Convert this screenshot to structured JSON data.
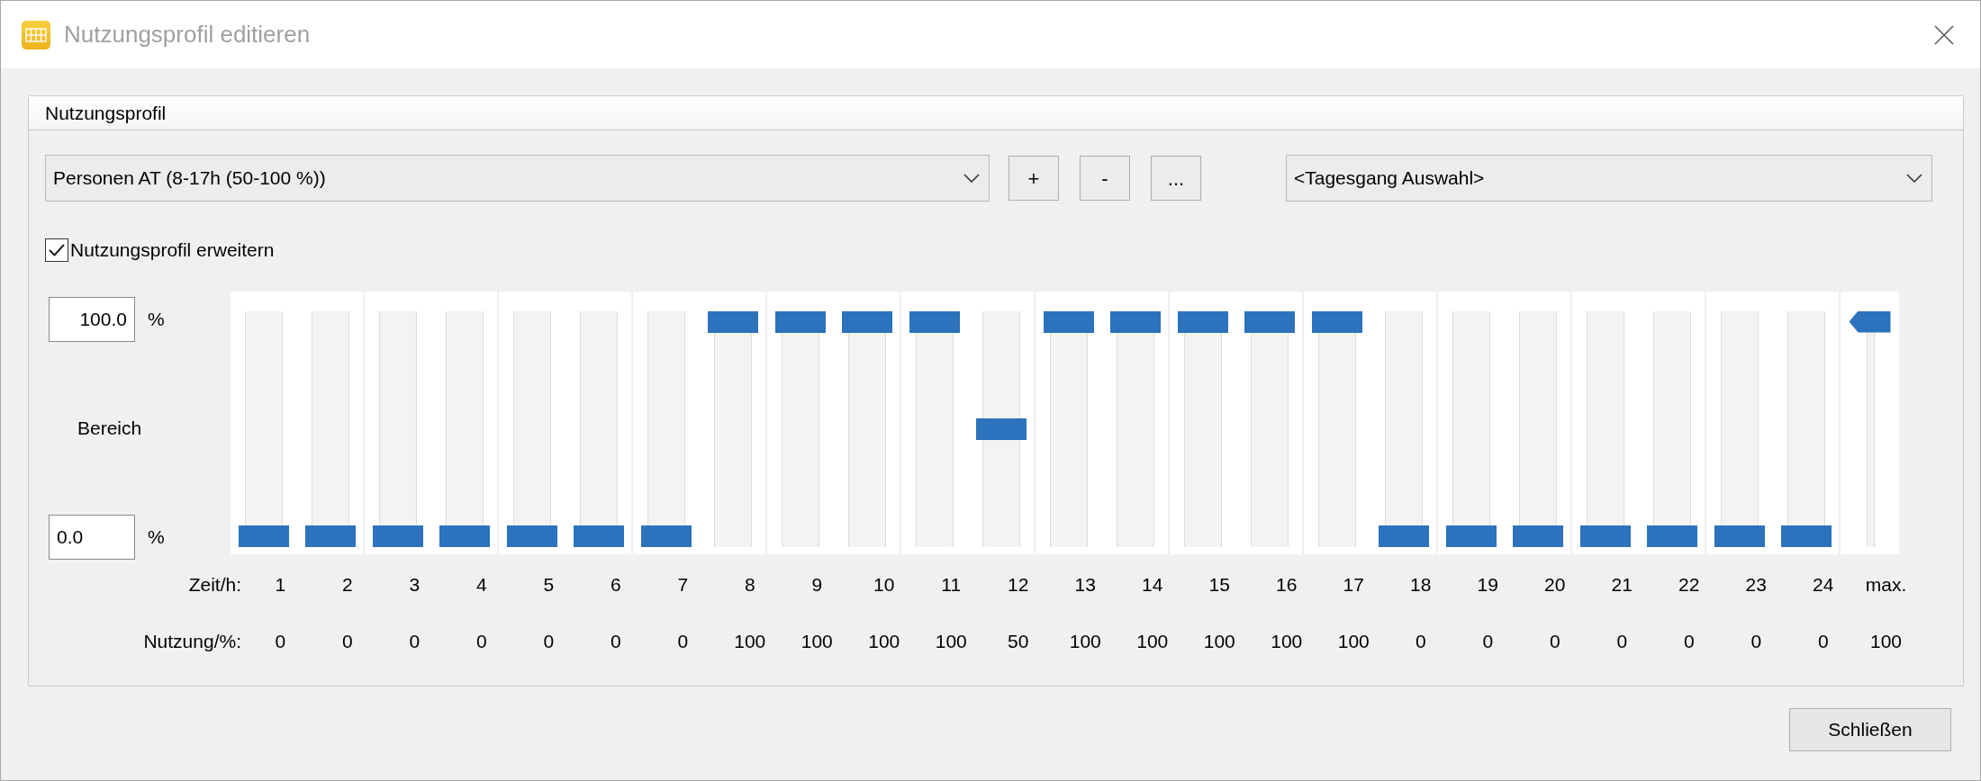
{
  "window": {
    "title": "Nutzungsprofil editieren"
  },
  "group": {
    "title": "Nutzungsprofil"
  },
  "profile_select": {
    "value": "Personen AT (8-17h (50-100 %))"
  },
  "profile_buttons": [
    "+",
    "-",
    "..."
  ],
  "daily_select": {
    "value": "<Tagesgang Auswahl>"
  },
  "extend": {
    "label": "Nutzungsprofil erweitern",
    "checked": true
  },
  "range": {
    "label": "Bereich",
    "max_value": "100.0",
    "max_unit": "%",
    "min_value": "0.0",
    "min_unit": "%"
  },
  "time_label": "Zeit/h:",
  "usage_label": "Nutzung/%:",
  "hours": [
    {
      "hour": "1",
      "usage": "0",
      "level": 0
    },
    {
      "hour": "2",
      "usage": "0",
      "level": 0
    },
    {
      "hour": "3",
      "usage": "0",
      "level": 0
    },
    {
      "hour": "4",
      "usage": "0",
      "level": 0
    },
    {
      "hour": "5",
      "usage": "0",
      "level": 0
    },
    {
      "hour": "6",
      "usage": "0",
      "level": 0
    },
    {
      "hour": "7",
      "usage": "0",
      "level": 0
    },
    {
      "hour": "8",
      "usage": "100",
      "level": 1
    },
    {
      "hour": "9",
      "usage": "100",
      "level": 1
    },
    {
      "hour": "10",
      "usage": "100",
      "level": 1
    },
    {
      "hour": "11",
      "usage": "100",
      "level": 1
    },
    {
      "hour": "12",
      "usage": "50",
      "level": 0.5
    },
    {
      "hour": "13",
      "usage": "100",
      "level": 1
    },
    {
      "hour": "14",
      "usage": "100",
      "level": 1
    },
    {
      "hour": "15",
      "usage": "100",
      "level": 1
    },
    {
      "hour": "16",
      "usage": "100",
      "level": 1
    },
    {
      "hour": "17",
      "usage": "100",
      "level": 1
    },
    {
      "hour": "18",
      "usage": "0",
      "level": 0
    },
    {
      "hour": "19",
      "usage": "0",
      "level": 0
    },
    {
      "hour": "20",
      "usage": "0",
      "level": 0
    },
    {
      "hour": "21",
      "usage": "0",
      "level": 0
    },
    {
      "hour": "22",
      "usage": "0",
      "level": 0
    },
    {
      "hour": "23",
      "usage": "0",
      "level": 0
    },
    {
      "hour": "24",
      "usage": "0",
      "level": 0
    }
  ],
  "max": {
    "label": "max.",
    "usage": "100",
    "level": 1
  },
  "close_button": "Schließen"
}
